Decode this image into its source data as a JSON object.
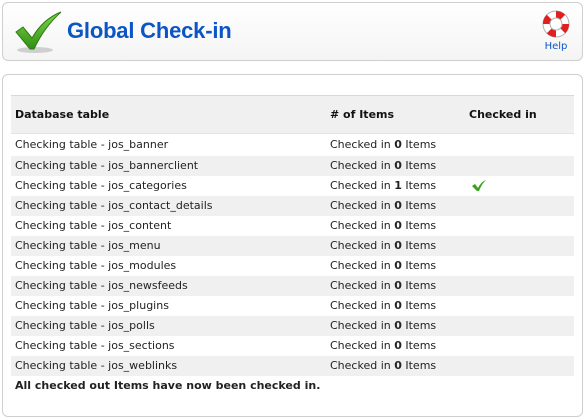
{
  "header": {
    "title": "Global Check-in",
    "help_label": "Help"
  },
  "table": {
    "columns": [
      "Database table",
      "# of Items",
      "Checked in"
    ],
    "rows": [
      {
        "table": "Checking table - jos_banner",
        "prefix": "Checked in ",
        "count": "0",
        "suffix": " Items",
        "checked": false
      },
      {
        "table": "Checking table - jos_bannerclient",
        "prefix": "Checked in ",
        "count": "0",
        "suffix": " Items",
        "checked": false
      },
      {
        "table": "Checking table - jos_categories",
        "prefix": "Checked in ",
        "count": "1",
        "suffix": " Items",
        "checked": true
      },
      {
        "table": "Checking table - jos_contact_details",
        "prefix": "Checked in ",
        "count": "0",
        "suffix": " Items",
        "checked": false
      },
      {
        "table": "Checking table - jos_content",
        "prefix": "Checked in ",
        "count": "0",
        "suffix": " Items",
        "checked": false
      },
      {
        "table": "Checking table - jos_menu",
        "prefix": "Checked in ",
        "count": "0",
        "suffix": " Items",
        "checked": false
      },
      {
        "table": "Checking table - jos_modules",
        "prefix": "Checked in ",
        "count": "0",
        "suffix": " Items",
        "checked": false
      },
      {
        "table": "Checking table - jos_newsfeeds",
        "prefix": "Checked in ",
        "count": "0",
        "suffix": " Items",
        "checked": false
      },
      {
        "table": "Checking table - jos_plugins",
        "prefix": "Checked in ",
        "count": "0",
        "suffix": " Items",
        "checked": false
      },
      {
        "table": "Checking table - jos_polls",
        "prefix": "Checked in ",
        "count": "0",
        "suffix": " Items",
        "checked": false
      },
      {
        "table": "Checking table - jos_sections",
        "prefix": "Checked in ",
        "count": "0",
        "suffix": " Items",
        "checked": false
      },
      {
        "table": "Checking table - jos_weblinks",
        "prefix": "Checked in ",
        "count": "0",
        "suffix": " Items",
        "checked": false
      }
    ],
    "footer": "All checked out Items have now been checked in."
  },
  "colors": {
    "title": "#0b55c4",
    "check": "#3aa21c",
    "row_alt": "#f0f0f0"
  },
  "icons": {
    "header": "checkmark-icon",
    "help": "lifebuoy-icon",
    "row_check": "checkmark-icon"
  }
}
